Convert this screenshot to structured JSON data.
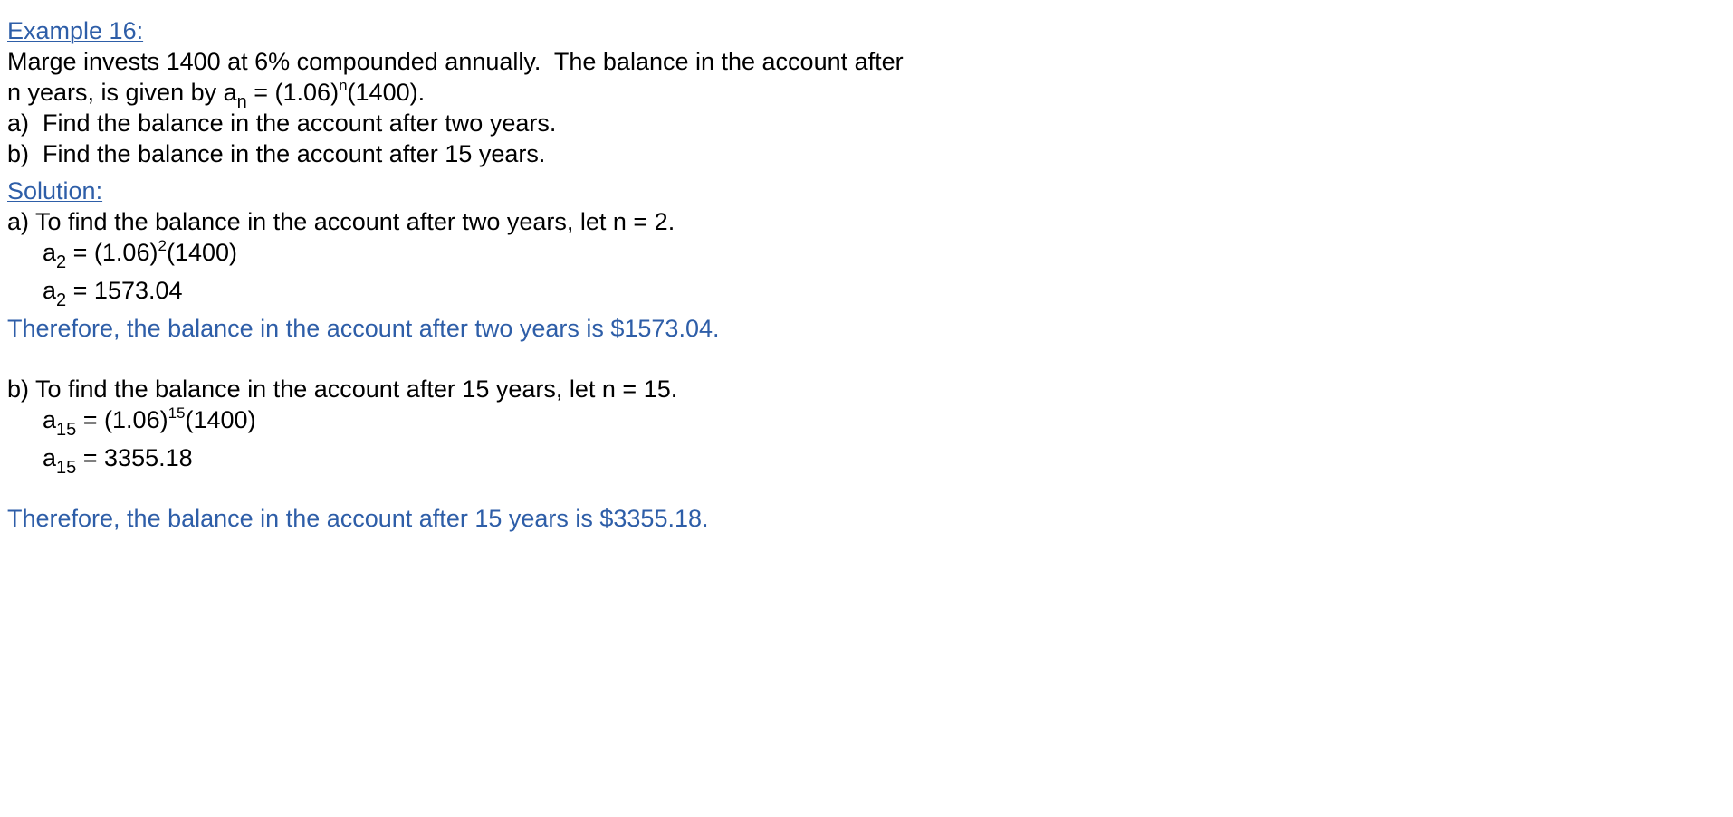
{
  "colors": {
    "accent": "#2e5ea8",
    "text": "#000000",
    "background": "#ffffff"
  },
  "example": {
    "title": "Example 16:",
    "line1": "Marge invests 1400 at 6% compounded annually.  The balance in the account after",
    "line2_pre": "n years, is given by a",
    "line2_sub": "n",
    "line2_mid": " = (1.06)",
    "line2_sup": "n",
    "line2_post": "(1400).",
    "question_a": "a)  Find the balance in the account after two years.",
    "question_b": "b)  Find the balance in the account after 15 years."
  },
  "solution": {
    "title": "Solution:",
    "part_a": {
      "intro": "a) To find the balance in the account after two years, let n = 2.",
      "eq1_var": "a",
      "eq1_sub": "2",
      "eq1_mid": " = (1.06)",
      "eq1_sup": "2",
      "eq1_post": "(1400)",
      "eq2_var": "a",
      "eq2_sub": "2",
      "eq2_post": " = 1573.04",
      "conclusion": "Therefore, the balance in the account after two years is $1573.04."
    },
    "part_b": {
      "intro": "b) To find the balance in the account after 15 years, let n = 15.",
      "eq1_var": "a",
      "eq1_sub": "15",
      "eq1_mid": " = (1.06)",
      "eq1_sup": "15",
      "eq1_post": "(1400)",
      "eq2_var": "a",
      "eq2_sub": "15",
      "eq2_post": " = 3355.18",
      "conclusion": "Therefore, the balance in the account after 15 years is $3355.18."
    }
  }
}
